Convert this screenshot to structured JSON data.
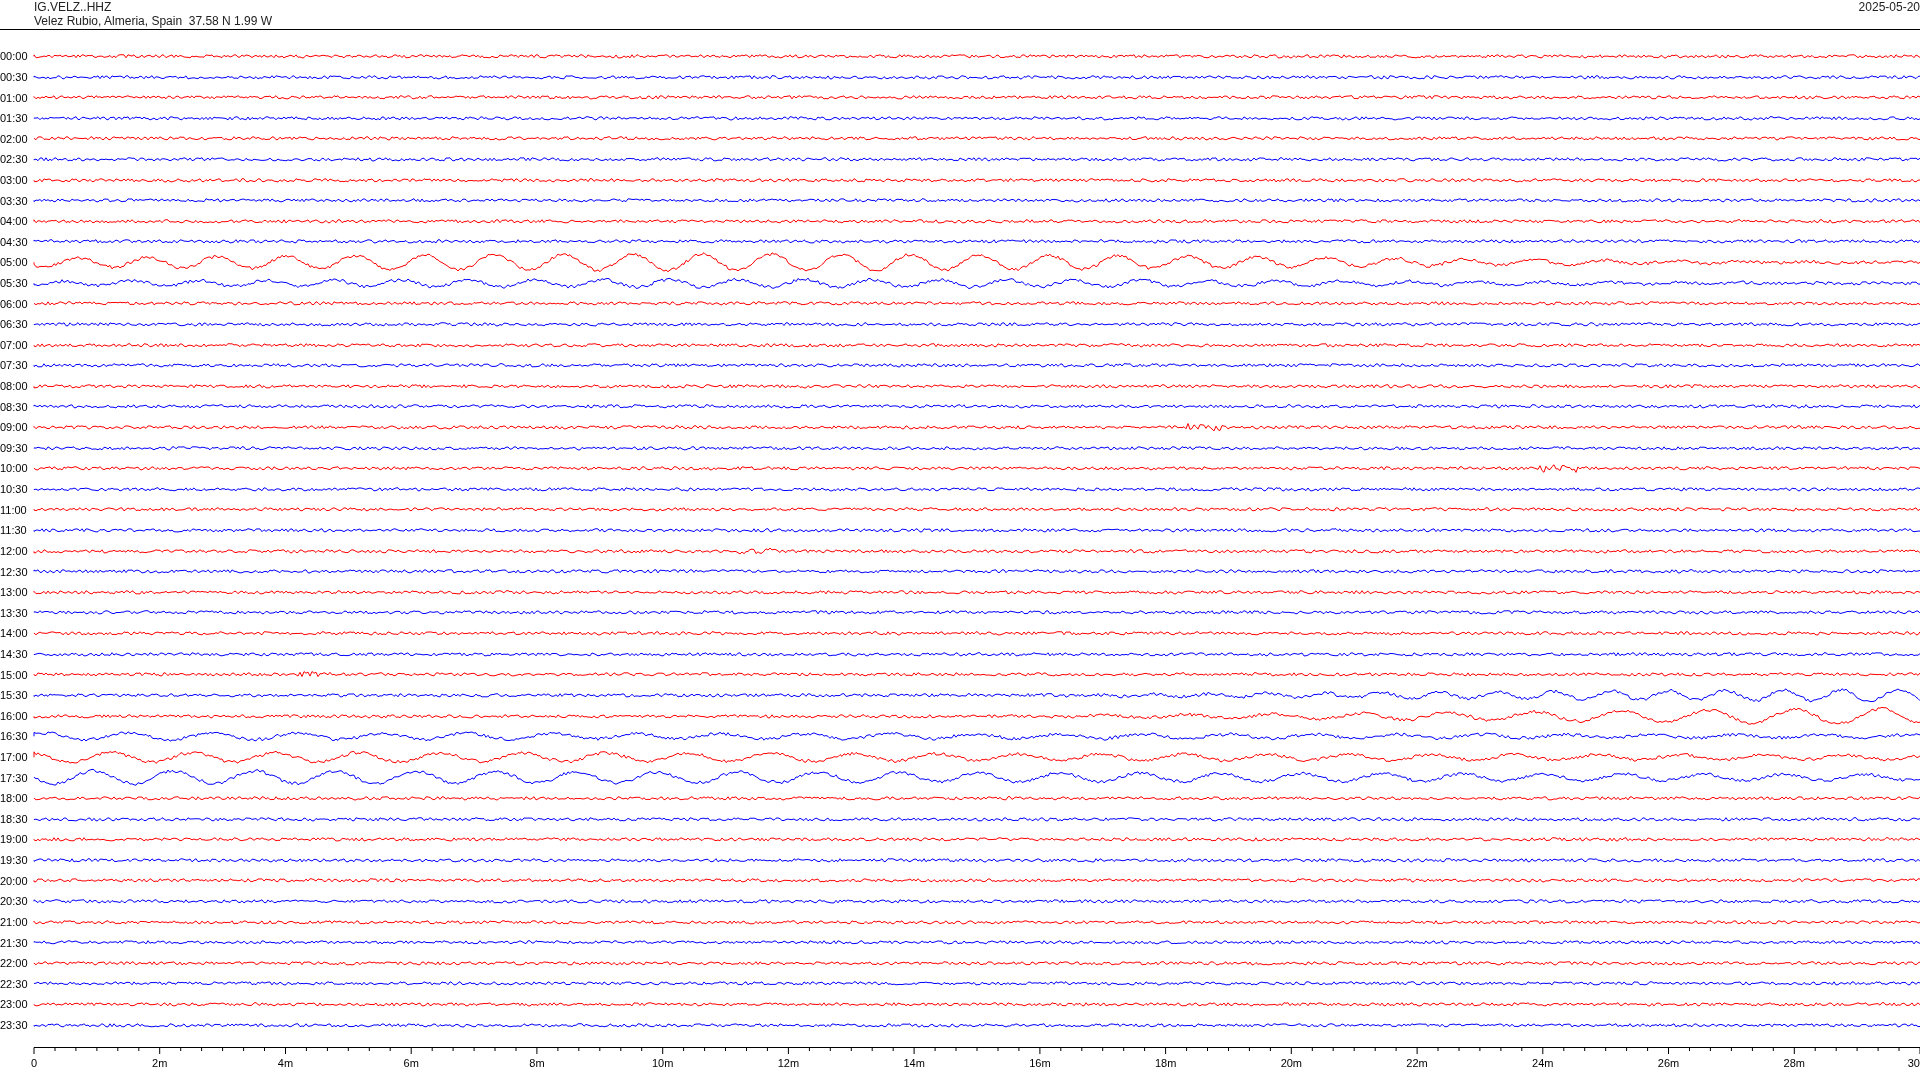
{
  "header": {
    "station": "IG.VELZ..HHZ",
    "location": "Velez Rubio, Almeria, Spain  37.58 N 1.99 W",
    "date": "2025-05-20"
  },
  "rows": [
    {
      "label": "00:00",
      "color": "#ff0000",
      "kind": "noise"
    },
    {
      "label": "00:30",
      "color": "#0000ff",
      "kind": "noise"
    },
    {
      "label": "01:00",
      "color": "#ff0000",
      "kind": "noise"
    },
    {
      "label": "01:30",
      "color": "#0000ff",
      "kind": "noise"
    },
    {
      "label": "02:00",
      "color": "#ff0000",
      "kind": "noise"
    },
    {
      "label": "02:30",
      "color": "#0000ff",
      "kind": "noise"
    },
    {
      "label": "03:00",
      "color": "#ff0000",
      "kind": "noise"
    },
    {
      "label": "03:30",
      "color": "#0000ff",
      "kind": "noise"
    },
    {
      "label": "04:00",
      "color": "#ff0000",
      "kind": "noise"
    },
    {
      "label": "04:30",
      "color": "#0000ff",
      "kind": "noise"
    },
    {
      "label": "05:00",
      "color": "#ff0000",
      "kind": "waves"
    },
    {
      "label": "05:30",
      "color": "#0000ff",
      "kind": "waves"
    },
    {
      "label": "06:00",
      "color": "#ff0000",
      "kind": "noise"
    },
    {
      "label": "06:30",
      "color": "#0000ff",
      "kind": "noise"
    },
    {
      "label": "07:00",
      "color": "#ff0000",
      "kind": "noise"
    },
    {
      "label": "07:30",
      "color": "#0000ff",
      "kind": "noise"
    },
    {
      "label": "08:00",
      "color": "#ff0000",
      "kind": "noise"
    },
    {
      "label": "08:30",
      "color": "#0000ff",
      "kind": "noise"
    },
    {
      "label": "09:00",
      "color": "#ff0000",
      "kind": "burst"
    },
    {
      "label": "09:30",
      "color": "#0000ff",
      "kind": "noise"
    },
    {
      "label": "10:00",
      "color": "#ff0000",
      "kind": "burst"
    },
    {
      "label": "10:30",
      "color": "#0000ff",
      "kind": "noise"
    },
    {
      "label": "11:00",
      "color": "#ff0000",
      "kind": "noise"
    },
    {
      "label": "11:30",
      "color": "#0000ff",
      "kind": "noise"
    },
    {
      "label": "12:00",
      "color": "#ff0000",
      "kind": "burst"
    },
    {
      "label": "12:30",
      "color": "#0000ff",
      "kind": "noise"
    },
    {
      "label": "13:00",
      "color": "#ff0000",
      "kind": "noise"
    },
    {
      "label": "13:30",
      "color": "#0000ff",
      "kind": "noise"
    },
    {
      "label": "14:00",
      "color": "#ff0000",
      "kind": "noise"
    },
    {
      "label": "14:30",
      "color": "#0000ff",
      "kind": "noise"
    },
    {
      "label": "15:00",
      "color": "#ff0000",
      "kind": "burst"
    },
    {
      "label": "15:30",
      "color": "#0000ff",
      "kind": "waves"
    },
    {
      "label": "16:00",
      "color": "#ff0000",
      "kind": "waves"
    },
    {
      "label": "16:30",
      "color": "#0000ff",
      "kind": "waves"
    },
    {
      "label": "17:00",
      "color": "#ff0000",
      "kind": "waves"
    },
    {
      "label": "17:30",
      "color": "#0000ff",
      "kind": "waves"
    },
    {
      "label": "18:00",
      "color": "#ff0000",
      "kind": "noise"
    },
    {
      "label": "18:30",
      "color": "#0000ff",
      "kind": "noise"
    },
    {
      "label": "19:00",
      "color": "#ff0000",
      "kind": "noise"
    },
    {
      "label": "19:30",
      "color": "#0000ff",
      "kind": "noise"
    },
    {
      "label": "20:00",
      "color": "#ff0000",
      "kind": "noise"
    },
    {
      "label": "20:30",
      "color": "#0000ff",
      "kind": "noise"
    },
    {
      "label": "21:00",
      "color": "#ff0000",
      "kind": "noise"
    },
    {
      "label": "21:30",
      "color": "#0000ff",
      "kind": "noise"
    },
    {
      "label": "22:00",
      "color": "#ff0000",
      "kind": "noise"
    },
    {
      "label": "22:30",
      "color": "#0000ff",
      "kind": "noise"
    },
    {
      "label": "23:00",
      "color": "#ff0000",
      "kind": "noise"
    },
    {
      "label": "23:30",
      "color": "#0000ff",
      "kind": "noise"
    }
  ],
  "time_axis": {
    "ticks": [
      "0",
      "2m",
      "4m",
      "6m",
      "8m",
      "10m",
      "12m",
      "14m",
      "16m",
      "18m",
      "20m",
      "22m",
      "24m",
      "26m",
      "28m",
      "30"
    ]
  }
}
